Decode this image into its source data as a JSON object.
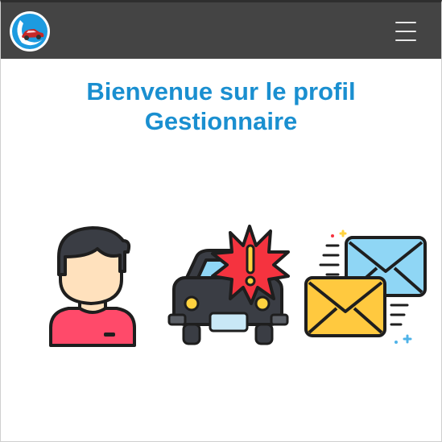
{
  "navbar": {
    "logo_icon": "car-logo-icon",
    "menu_icon": "hamburger-menu-icon",
    "background": "#444444"
  },
  "main": {
    "title_line1": "Bienvenue sur le profil",
    "title_line2": "Gestionnaire",
    "title_color": "#1a8fd0"
  },
  "tiles": [
    {
      "icon": "user-profile-icon"
    },
    {
      "icon": "car-accident-icon"
    },
    {
      "icon": "messages-icon"
    }
  ]
}
